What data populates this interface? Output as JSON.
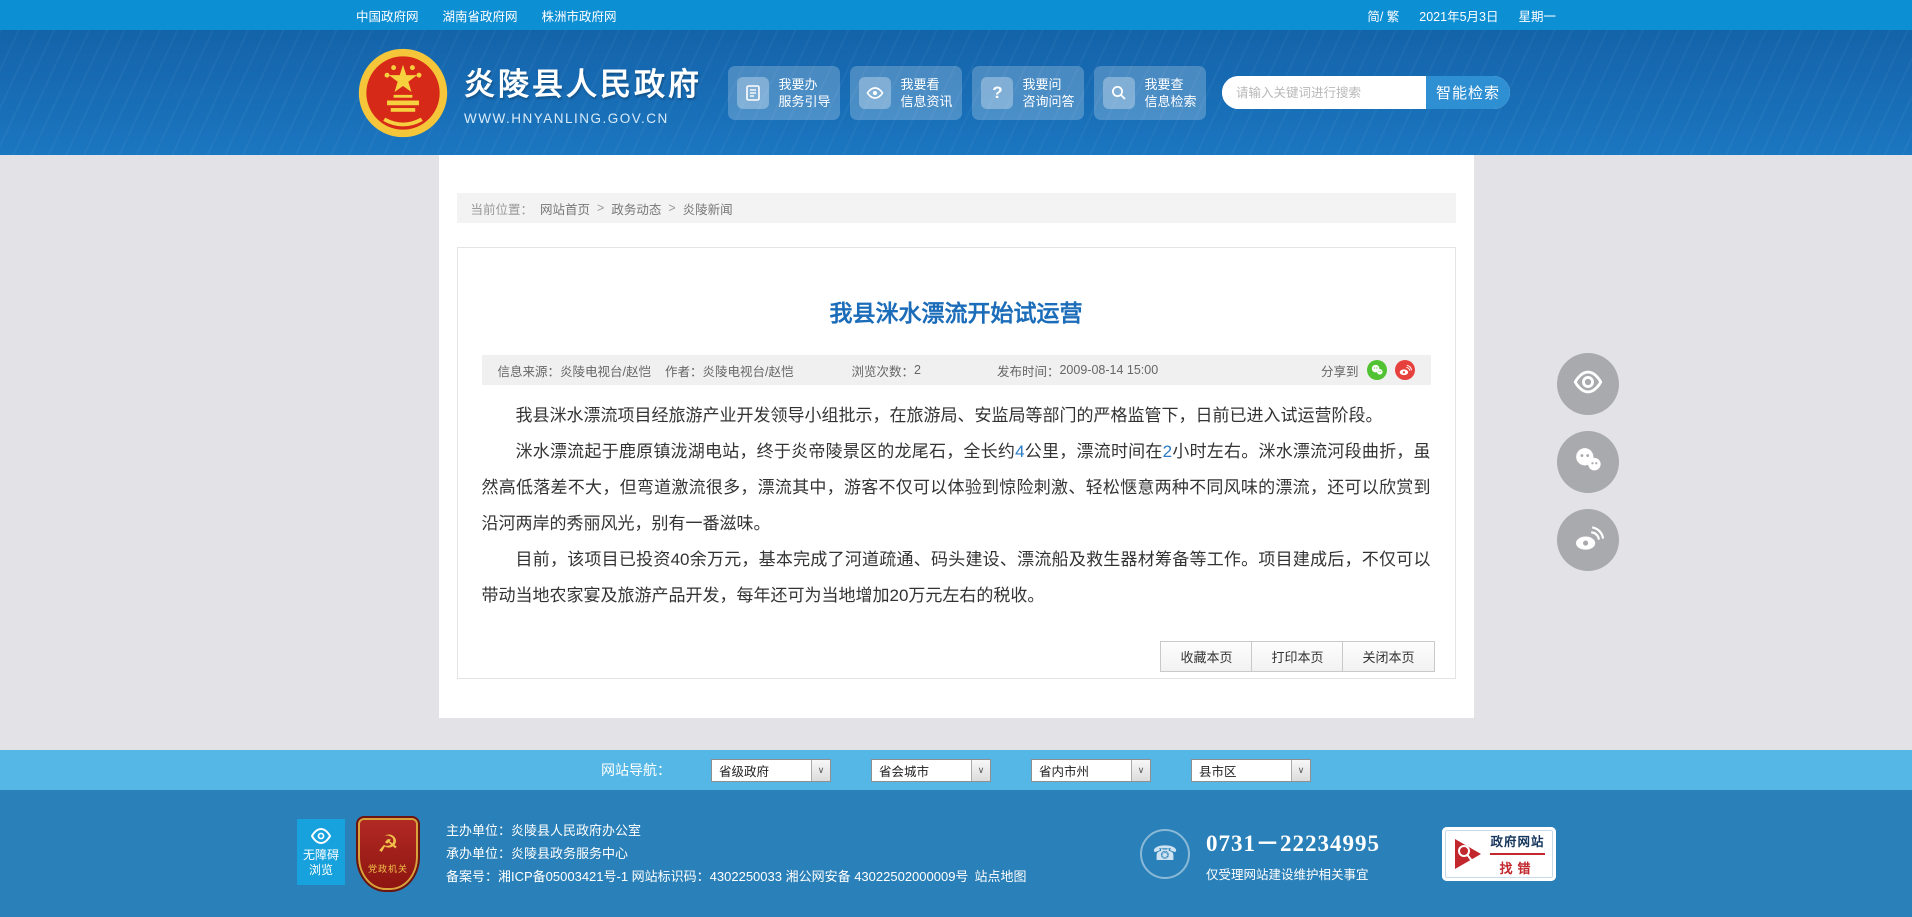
{
  "topbar": {
    "links": [
      "中国政府网",
      "湖南省政府网",
      "株洲市政府网"
    ],
    "lang_toggle": "简/ 繁",
    "date": "2021年5月3日",
    "weekday": "星期一"
  },
  "header": {
    "site_name": "炎陵县人民政府",
    "site_url": "WWW.HNYANLING.GOV.CN",
    "quick_buttons": [
      {
        "line1": "我要办",
        "line2": "服务引导",
        "icon": "document-icon"
      },
      {
        "line1": "我要看",
        "line2": "信息资讯",
        "icon": "eye-icon"
      },
      {
        "line1": "我要问",
        "line2": "咨询问答",
        "icon": "question-icon"
      },
      {
        "line1": "我要查",
        "line2": "信息检索",
        "icon": "search-icon"
      }
    ],
    "search": {
      "placeholder": "请输入关键词进行搜索",
      "button_label": "智能检索"
    }
  },
  "breadcrumb": {
    "label": "当前位置：",
    "separator": ">",
    "items": [
      "网站首页",
      "政务动态",
      "炎陵新闻"
    ]
  },
  "article": {
    "title": "我县洣水漂流开始试运营",
    "meta": {
      "source_label": "信息来源：",
      "source": "炎陵电视台/赵恺",
      "author_label": "作者：",
      "author": "炎陵电视台/赵恺",
      "views_label": "浏览次数：",
      "views": "2",
      "time_label": "发布时间：",
      "time": "2009-08-14 15:00",
      "share_label": "分享到"
    },
    "paragraphs": {
      "p1": "我县洣水漂流项目经旅游产业开发领导小组批示，在旅游局、安监局等部门的严格监管下，日前已进入试运营阶段。",
      "p2a": "洣水漂流起于鹿原镇泷湖电站，终于炎帝陵景区的龙尾石，全长约",
      "p2n1": "4",
      "p2b": "公里，漂流时间在",
      "p2n2": "2",
      "p2c": "小时左右。洣水漂流河段曲折，虽然高低落差不大，但弯道激流很多，漂流其中，游客不仅可以体验到惊险刺激、轻松惬意两种不同风味的漂流，还可以欣赏到沿河两岸的秀丽风光，别有一番滋味。",
      "p3": "目前，该项目已投资40余万元，基本完成了河道疏通、码头建设、漂流船及救生器材筹备等工作。项目建成后，不仅可以带动当地农家宴及旅游产品开发，每年还可为当地增加20万元左右的税收。"
    },
    "actions": [
      "收藏本页",
      "打印本页",
      "关闭本页"
    ]
  },
  "accessibility": {
    "line1": "无障碍",
    "line2": "浏览"
  },
  "nav_bar": {
    "label": "网站导航：",
    "selects": [
      "省级政府",
      "省会城市",
      "省内市州",
      "县市区"
    ]
  },
  "footer": {
    "badge_label": "党政机关",
    "org_lines": [
      {
        "label": "主办单位：",
        "value": "炎陵县人民政府办公室"
      },
      {
        "label": "承办单位：",
        "value": "炎陵县政务服务中心"
      }
    ],
    "record_line": "备案号：湘ICP备05003421号-1 网站标识码：4302250033 湘公网安备 43022502000009号",
    "sitemap": "站点地图",
    "phone": "0731－22234995",
    "phone_note": "仅受理网站建设维护相关事宜",
    "error_badge": {
      "line1": "政府网站",
      "line2": "找错"
    }
  },
  "colors": {
    "topbar_blue": "#0d8fd4",
    "header_blue": "#1768b2",
    "navbar_blue": "#54b7e5",
    "footer_blue": "#2a80b8",
    "title_blue": "#1b6cb9",
    "accent_number_blue": "#2a7cc8",
    "wechat_green": "#51c332",
    "weibo_red": "#e6413c",
    "badge_red": "#b01f24"
  }
}
